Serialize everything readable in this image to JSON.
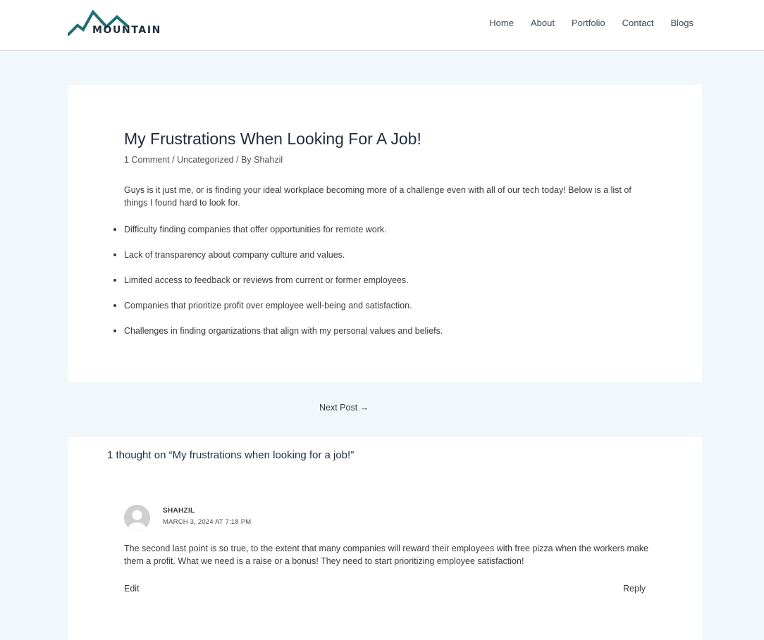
{
  "site": {
    "logo_text": "MOUNTAIN",
    "brand_color": "#1e6f74"
  },
  "nav": {
    "items": [
      {
        "label": "Home"
      },
      {
        "label": "About"
      },
      {
        "label": "Portfolio"
      },
      {
        "label": "Contact"
      },
      {
        "label": "Blogs"
      }
    ]
  },
  "post": {
    "title": "My Frustrations When Looking For A Job!",
    "meta": {
      "comments_link": "1 Comment",
      "sep1": " / ",
      "category": "Uncategorized",
      "sep2": " / By ",
      "author": "Shahzil"
    },
    "intro": "Guys is it just me, or is finding your ideal workplace becoming more of a challenge even with all of our tech today! Below is a list of things I found hard to look for.",
    "bullets": [
      "Difficulty finding companies that offer opportunities for remote work.",
      "Lack of transparency about company culture and values.",
      "Limited access to feedback or reviews from current or former employees.",
      "Companies that prioritize profit over employee well-being and satisfaction.",
      "Challenges in finding organizations that align with my personal values and beliefs."
    ]
  },
  "navigation": {
    "next_post": "Next Post →"
  },
  "comments": {
    "heading": "1 thought on “My frustrations when looking for a job!”",
    "items": [
      {
        "author": "SHAHZIL",
        "date": "MARCH 3, 2024 AT 7:18 PM",
        "body": "The second last point is so true, to the extent that many companies will reward their employees with free pizza when the workers make them a profit. What we need is a raise or a bonus! They need to start prioritizing employee satisfaction!",
        "edit_label": "Edit",
        "reply_label": "Reply"
      }
    ]
  }
}
